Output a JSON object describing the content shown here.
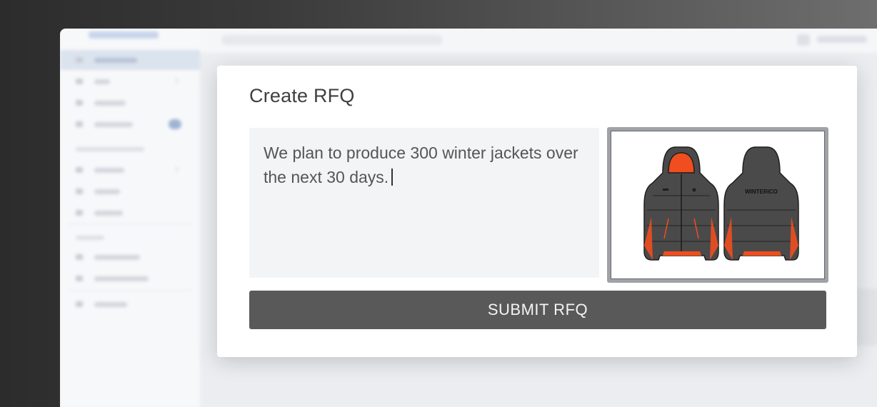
{
  "modal": {
    "title": "Create RFQ",
    "description_value": "We plan to produce 300 winter jackets over the next 30 days.",
    "submit_label": "SUBMIT RFQ",
    "image": {
      "brand_text": "WINTERICO",
      "jacket_color": "#4a4a4a",
      "accent_color": "#f04e1e"
    }
  },
  "colors": {
    "submit_button": "#595959",
    "backdrop_dark": "#2c2c2c"
  }
}
